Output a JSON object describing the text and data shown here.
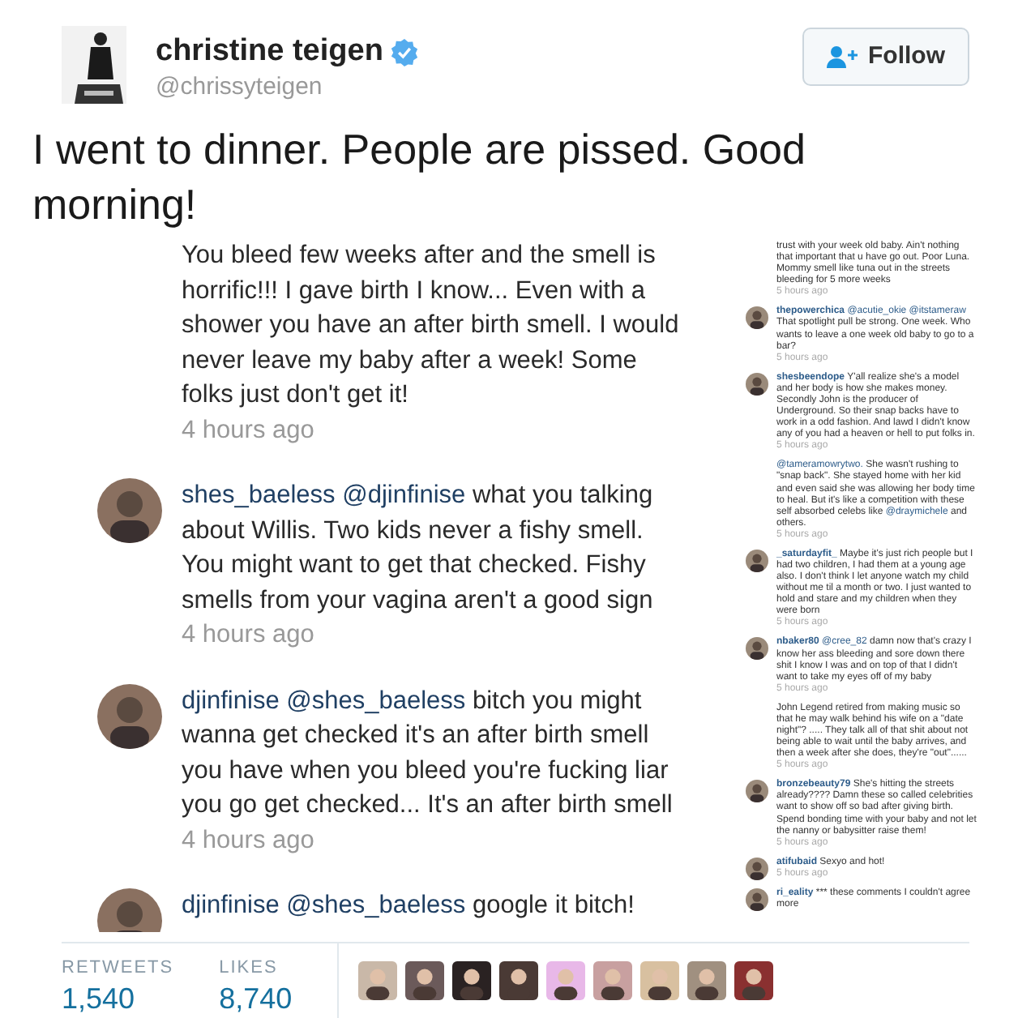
{
  "tweet": {
    "author": {
      "name": "christine teigen",
      "handle": "@chrissyteigen",
      "verified": true
    },
    "follow_button": "Follow",
    "text": "I went to dinner. People are pissed. Good morning!",
    "attached_image": {
      "left_comments": [
        {
          "parts": [
            {
              "kind": "plain",
              "text": "You bleed few weeks after and the smell is horrific!!! I gave birth I know... Even with a shower you have an after birth smell. I would never leave my baby after a week! Some folks just don't get it!"
            }
          ],
          "time": "4 hours ago"
        },
        {
          "user": "shes_baeless",
          "parts": [
            {
              "kind": "mention",
              "text": "@djinfinise"
            },
            {
              "kind": "plain",
              "text": " what you talking about Willis. Two kids never a fishy smell. You might want to get that checked. Fishy smells from your vagina aren't a good sign"
            }
          ],
          "time": "4 hours ago"
        },
        {
          "user": "djinfinise",
          "parts": [
            {
              "kind": "mention",
              "text": "@shes_baeless"
            },
            {
              "kind": "plain",
              "text": " bitch you might wanna get checked it's an after birth smell you have when you bleed you're fucking liar you go get checked... It's an after birth smell"
            }
          ],
          "time": "4 hours ago"
        },
        {
          "user": "djinfinise",
          "parts": [
            {
              "kind": "mention",
              "text": "@shes_baeless"
            },
            {
              "kind": "plain",
              "text": " google it bitch!"
            }
          ]
        }
      ],
      "right_comments": [
        {
          "parts": [
            {
              "kind": "plain",
              "text": "trust with your week old baby. Ain't nothing that important that u have go out. Poor Luna. Mommy smell like tuna out in the streets bleeding for 5 more weeks"
            }
          ],
          "time": "5 hours ago"
        },
        {
          "user": "thepowerchica",
          "parts": [
            {
              "kind": "mention",
              "text": "@acutie_okie @itstameraw"
            },
            {
              "kind": "plain",
              "text": " That spotlight pull be strong. One week. Who wants to leave a one week old baby to go to a bar?"
            }
          ],
          "time": "5 hours ago"
        },
        {
          "user": "shesbeendope",
          "parts": [
            {
              "kind": "plain",
              "text": "Y'all realize she's a model and her body is how she makes money. Secondly John is the producer of Underground. So their snap backs have to work in a odd fashion. And lawd I didn't know any of you had a heaven or hell to put folks in."
            }
          ],
          "time": "5 hours ago"
        },
        {
          "parts": [
            {
              "kind": "mention",
              "text": "@tameramowrytwo."
            },
            {
              "kind": "plain",
              "text": " She wasn't rushing to \"snap back\". She stayed home with her kid and even said she was allowing her body time to heal. But it's like a competition with these self absorbed celebs like "
            },
            {
              "kind": "mention",
              "text": "@draymichele"
            },
            {
              "kind": "plain",
              "text": " and others."
            }
          ],
          "time": "5 hours ago"
        },
        {
          "user": "_saturdayfit_",
          "parts": [
            {
              "kind": "plain",
              "text": "Maybe it's just rich people but I had two children, I had them at a young age also. I don't think I let anyone watch my child without me til a month or two. I just wanted to hold and stare and my children when they were born"
            }
          ],
          "time": "5 hours ago"
        },
        {
          "user": "nbaker80",
          "parts": [
            {
              "kind": "mention",
              "text": "@cree_82"
            },
            {
              "kind": "plain",
              "text": " damn now that's crazy I know her ass bleeding and sore down there shit I know I was and on top of that I didn't want to take my eyes off of my baby"
            }
          ],
          "time": "5 hours ago"
        },
        {
          "parts": [
            {
              "kind": "plain",
              "text": "John Legend retired from making music so that he may walk behind his wife on a \"date night\"? ..... They talk all of that shit about not being able to wait until the baby arrives, and then a week after she does, they're \"out\"......"
            }
          ],
          "time": "5 hours ago"
        },
        {
          "user": "bronzebeauty79",
          "parts": [
            {
              "kind": "plain",
              "text": "She's hitting the streets already???? Damn these so called celebrities want to show off so bad after giving birth. Spend bonding time with your baby and not let the nanny or babysitter raise them!"
            }
          ],
          "time": "5 hours ago"
        },
        {
          "user": "atifubaid",
          "parts": [
            {
              "kind": "plain",
              "text": "Sexyo and hot!"
            }
          ],
          "time": "5 hours ago"
        },
        {
          "user": "ri_eality",
          "parts": [
            {
              "kind": "plain",
              "text": "*** these comments I couldn't agree more"
            }
          ]
        }
      ]
    },
    "stats": [
      {
        "label": "RETWEETS",
        "value": "1,540"
      },
      {
        "label": "LIKES",
        "value": "8,740"
      }
    ],
    "likers": [
      {
        "kind": "avatar"
      },
      {
        "kind": "avatar"
      },
      {
        "kind": "avatar"
      },
      {
        "kind": "avatar"
      },
      {
        "kind": "avatar"
      },
      {
        "kind": "avatar"
      },
      {
        "kind": "avatar"
      },
      {
        "kind": "avatar"
      },
      {
        "kind": "avatar"
      }
    ]
  }
}
